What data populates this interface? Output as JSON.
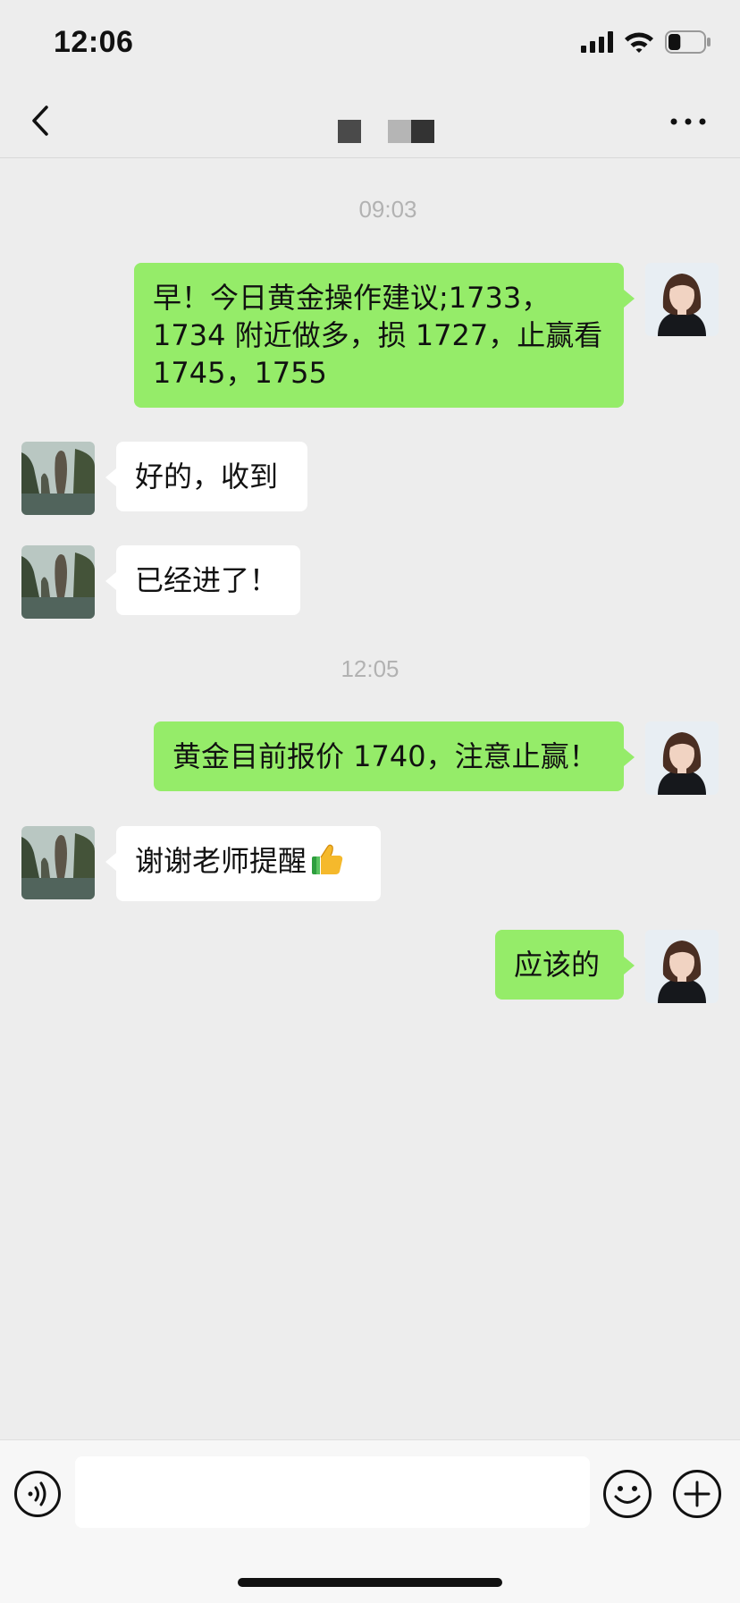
{
  "status_bar": {
    "time": "12:06",
    "icons": [
      "signal-icon",
      "wifi-icon",
      "battery-icon"
    ],
    "battery_level": 0.35
  },
  "nav": {
    "back_icon": "chevron-left-icon",
    "title_redacted": true,
    "more_icon": "more-icon"
  },
  "chat": {
    "timestamps": [
      "09:03",
      "12:05"
    ],
    "messages": [
      {
        "sender": "self",
        "text": "早！今日黄金操作建议;1733，1734 附近做多，损 1727，止赢看 1745，1755"
      },
      {
        "sender": "other",
        "text": "好的，收到"
      },
      {
        "sender": "other",
        "text": "已经进了！"
      },
      {
        "sender": "self",
        "text": "黄金目前报价 1740，注意止赢！"
      },
      {
        "sender": "other",
        "text": "谢谢老师提醒",
        "emoji": "thumbs-up-icon"
      },
      {
        "sender": "self",
        "text": "应该的"
      }
    ]
  },
  "input_bar": {
    "placeholder": "",
    "icons": [
      "voice-icon",
      "emoji-icon",
      "plus-icon"
    ]
  },
  "colors": {
    "background": "#EDEDED",
    "outgoing_bubble": "#95EC69",
    "incoming_bubble": "#FFFFFF",
    "timestamp_text": "#B2B2B2"
  }
}
